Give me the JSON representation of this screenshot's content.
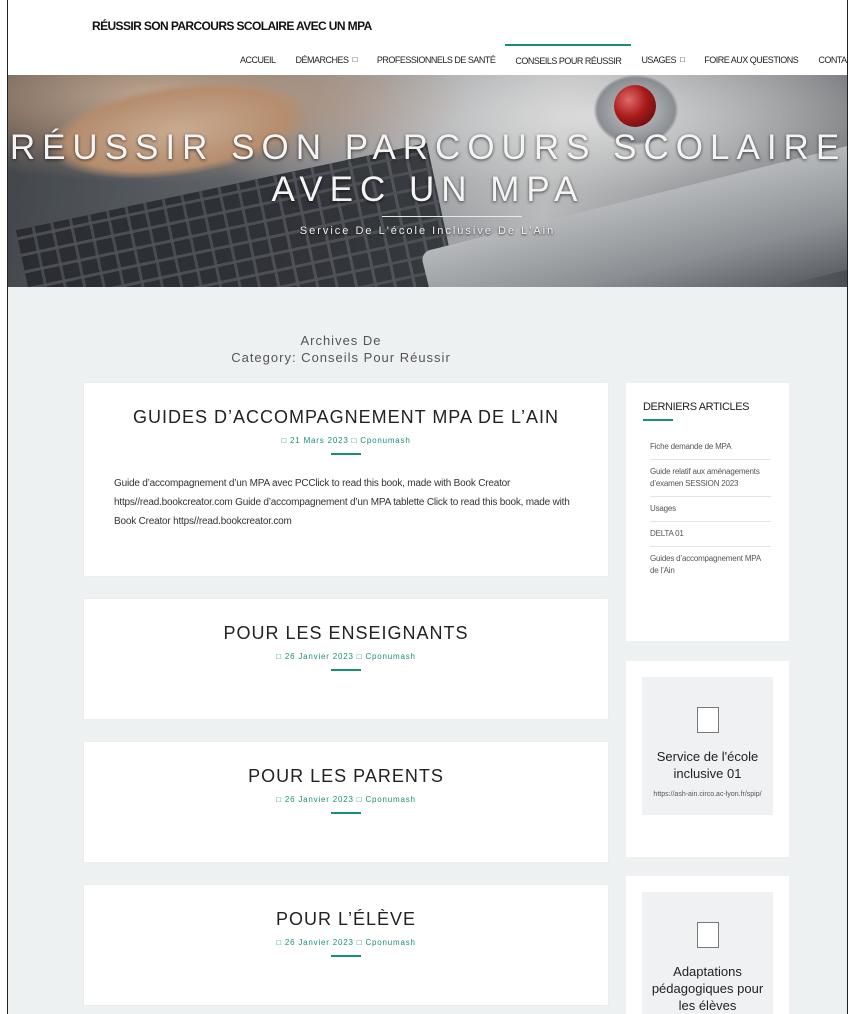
{
  "header": {
    "site_title": "RÉUSSIR SON PARCOURS SCOLAIRE AVEC UN MPA",
    "nav": [
      {
        "label": "ACCUEIL",
        "has_submenu": false,
        "active": false
      },
      {
        "label": "DÉMARCHES",
        "has_submenu": true,
        "active": false
      },
      {
        "label": "PROFESSIONNELS DE SANTÉ",
        "has_submenu": false,
        "active": false
      },
      {
        "label": "CONSEILS POUR RÉUSSIR",
        "has_submenu": false,
        "active": true
      },
      {
        "label": "USAGES",
        "has_submenu": true,
        "active": false
      },
      {
        "label": "FOIRE AUX QUESTIONS",
        "has_submenu": false,
        "active": false
      },
      {
        "label": "CONTACT",
        "has_submenu": false,
        "active": false
      }
    ],
    "submenu_icon": "□"
  },
  "hero": {
    "title_line1": "RÉUSSIR SON PARCOURS SCOLAIRE",
    "title_line2": "AVEC UN MPA",
    "subtitle": "Service De L'école Inclusive De L'Ain"
  },
  "archive": {
    "line1": "Archives De",
    "line2": "Category: Conseils Pour Réussir"
  },
  "posts": [
    {
      "title": "GUIDES D’ACCOMPAGNEMENT MPA DE L’AIN",
      "meta": "□ 21 Mars 2023 □ Cponumash",
      "excerpt": "Guide d’accompagnement d’un MPA avec PCClick to read this book, made with Book Creator https//read.bookcreator.com Guide d’accompagnement d’un MPA tablette Click to read this book, made with Book Creator https//read.bookcreator.com"
    },
    {
      "title": "POUR LES ENSEIGNANTS",
      "meta": "□ 26 Janvier 2023 □ Cponumash",
      "excerpt": ""
    },
    {
      "title": "POUR LES PARENTS",
      "meta": "□ 26 Janvier 2023 □ Cponumash",
      "excerpt": ""
    },
    {
      "title": "POUR L’ÉLÈVE",
      "meta": "□ 26 Janvier 2023 □ Cponumash",
      "excerpt": ""
    }
  ],
  "sidebar": {
    "recent_title": "DERNIERS ARTICLES",
    "recent_items": [
      "Fiche demande de MPA",
      "Guide relatif aux aménagements d’examen SESSION 2023",
      "Usages",
      "DELTA 01",
      "Guides d’accompagnement MPA de l’Ain"
    ],
    "box1": {
      "title": "Service de l'école inclusive 01",
      "url": "https://ash-ain.circo.ac-lyon.fr/spip/",
      "icon": "image-placeholder-icon"
    },
    "box2": {
      "title": "Adaptations pédagogiques pour les élèves",
      "icon": "image-placeholder-icon"
    }
  },
  "colors": {
    "accent": "#1a8f77",
    "page_bg": "#eef1f2",
    "card_bg": "#ffffff"
  }
}
